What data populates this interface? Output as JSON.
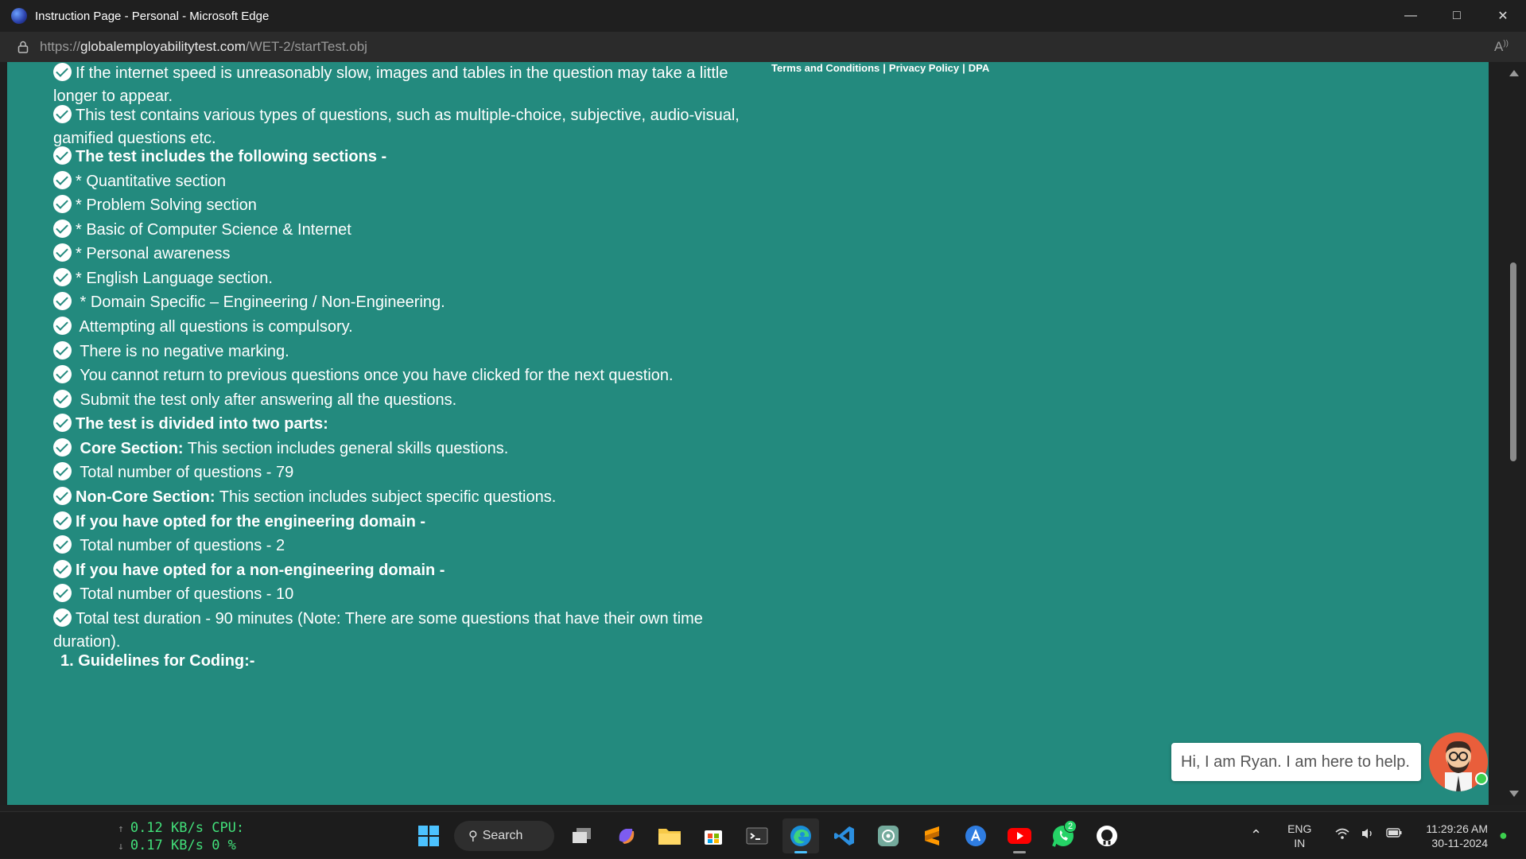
{
  "window": {
    "title": "Instruction Page - Personal - Microsoft Edge"
  },
  "address": {
    "scheme": "https://",
    "host": "globalemployabilitytest.com",
    "path": "/WET-2/startTest.obj"
  },
  "footer_links": {
    "terms": "Terms and Conditions",
    "sep": "|",
    "privacy": "Privacy Policy",
    "dpa": "DPA"
  },
  "instructions": [
    {
      "text": "If the internet speed is unreasonably slow, images and tables in the question may take a little longer to appear."
    },
    {
      "text": "This test contains various types of questions, such as multiple-choice, subjective, audio-visual, gamified questions etc."
    },
    {
      "text": "The test includes the following sections -",
      "bold": true
    },
    {
      "text": "* Quantitative section"
    },
    {
      "text": "* Problem Solving section"
    },
    {
      "text": "* Basic of Computer Science & Internet"
    },
    {
      "text": "* Personal awareness"
    },
    {
      "text": "* English Language section."
    },
    {
      "text": " * Domain Specific – Engineering / Non-Engineering."
    },
    {
      "text": " Attempting all questions is compulsory."
    },
    {
      "text": " There is no negative marking."
    },
    {
      "text": " You cannot return to previous questions once you have clicked for the next question."
    },
    {
      "text": " Submit the test only after answering all the questions."
    },
    {
      "text": "The test is divided into two parts:",
      "bold": true
    },
    {
      "lead": " Core Section:",
      "text": " This section includes general skills questions."
    },
    {
      "text": " Total number of questions - 79"
    },
    {
      "lead": "Non-Core Section:",
      "text": " This section includes subject specific questions."
    },
    {
      "text": "If you have opted for the engineering domain -",
      "bold": true
    },
    {
      "text": " Total number of questions - 2"
    },
    {
      "text": "If you have opted for a non-engineering domain -",
      "bold": true
    },
    {
      "text": " Total number of questions - 10"
    },
    {
      "text": "Total test duration - 90 minutes (Note: There are some questions that have their own time duration)."
    }
  ],
  "coding_heading": "1. Guidelines for Coding:-",
  "chat": {
    "message": "Hi, I am Ryan. I am here to help."
  },
  "taskbar": {
    "net_up": "0.12 KB/s",
    "net_down": "0.17 KB/s",
    "cpu_label": "CPU:",
    "cpu_value": "0 %",
    "search_label": "Search",
    "whatsapp_badge": "2",
    "lang_top": "ENG",
    "lang_bottom": "IN",
    "time": "11:29:26 AM",
    "date": "30-11-2024"
  },
  "colors": {
    "page_bg": "#238a7e",
    "chat_avatar": "#e95e3b"
  }
}
